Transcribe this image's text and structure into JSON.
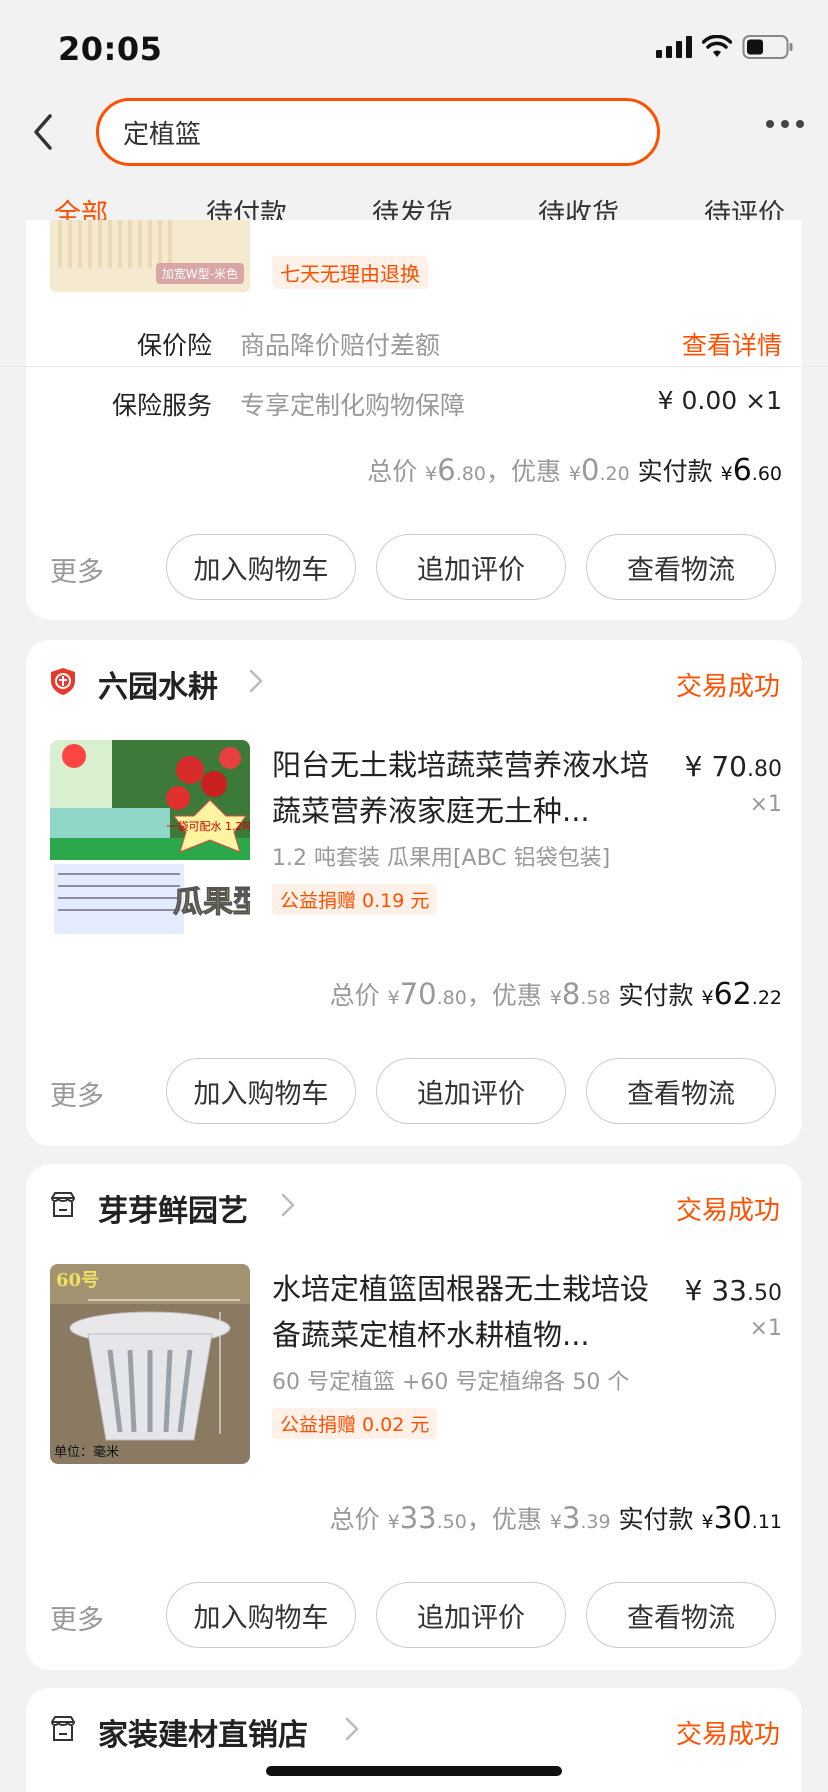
{
  "status_bar": {
    "time": "20:05"
  },
  "search": {
    "value": "定植篮"
  },
  "tabs": [
    {
      "label": "全部",
      "active": true
    },
    {
      "label": "待付款"
    },
    {
      "label": "待发货"
    },
    {
      "label": "待收货"
    },
    {
      "label": "待评价"
    }
  ],
  "order1": {
    "image_tag": "加宽W型-米色",
    "badge": "七天无理由退换",
    "price_protect": {
      "label": "保价险",
      "desc": "商品降价赔付差额",
      "action": "查看详情"
    },
    "insurance": {
      "label": "保险服务",
      "desc": "专享定制化购物保障",
      "price": "¥ 0.00 ×1"
    },
    "totals": {
      "total_label": "总价",
      "total_int": "6",
      "total_dec": ".80",
      "discount_label": "，优惠",
      "discount_int": "0",
      "discount_dec": ".20",
      "paid_label": "实付款",
      "paid_int": "6",
      "paid_dec": ".60",
      "currency": "¥"
    }
  },
  "actions": {
    "more": "更多",
    "add_cart": "加入购物车",
    "add_review": "追加评价",
    "logistics": "查看物流"
  },
  "order2": {
    "shop": "六园水耕",
    "status": "交易成功",
    "title": "阳台无土栽培蔬菜营养液水培蔬菜营养液家庭无土种...",
    "spec": "1.2 吨套装  瓜果用[ABC 铝袋包装]",
    "donate": "公益捐赠 0.19 元",
    "price_int": "¥ 70",
    "price_dec": ".80",
    "qty": "×1",
    "img_text": "瓜果型",
    "img_badge": "一袋可配水 1.2吨",
    "totals": {
      "total_label": "总价",
      "total_int": "70",
      "total_dec": ".80",
      "discount_label": "，优惠",
      "discount_int": "8",
      "discount_dec": ".58",
      "paid_label": "实付款",
      "paid_int": "62",
      "paid_dec": ".22",
      "currency": "¥"
    }
  },
  "order3": {
    "shop": "芽芽鲜园艺",
    "status": "交易成功",
    "title": "水培定植篮固根器无土栽培设备蔬菜定植杯水耕植物...",
    "spec": "60 号定植篮 +60 号定植绵各 50 个",
    "donate": "公益捐赠 0.02 元",
    "price_int": "¥ 33",
    "price_dec": ".50",
    "qty": "×1",
    "img_label": "60号",
    "img_unit": "单位：毫米",
    "totals": {
      "total_label": "总价",
      "total_int": "33",
      "total_dec": ".50",
      "discount_label": "，优惠",
      "discount_int": "3",
      "discount_dec": ".39",
      "paid_label": "实付款",
      "paid_int": "30",
      "paid_dec": ".11",
      "currency": "¥"
    }
  },
  "order4": {
    "shop": "家装建材直销店",
    "status": "交易成功"
  },
  "colors": {
    "accent": "#ff5000",
    "background": "#f2f2f2"
  }
}
